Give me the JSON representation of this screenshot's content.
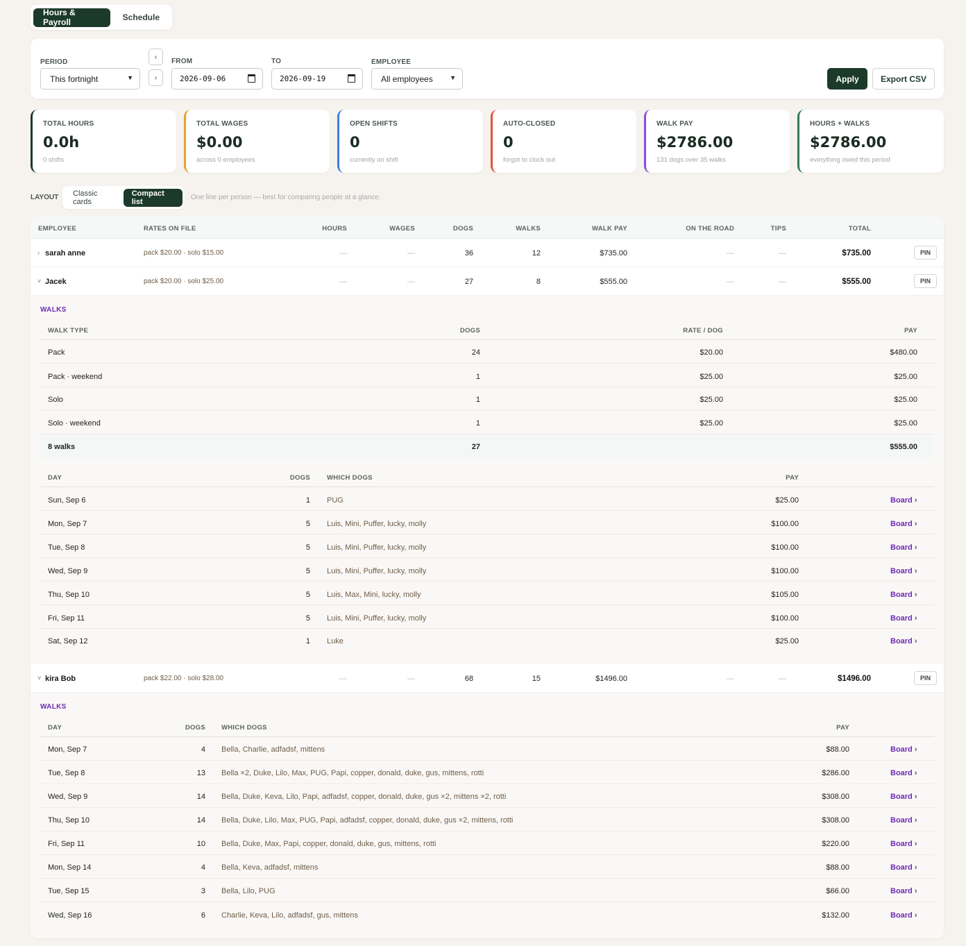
{
  "tabs": [
    {
      "label": "Hours & Payroll",
      "active": true
    },
    {
      "label": "Schedule",
      "active": false
    }
  ],
  "filters": {
    "period_label": "PERIOD",
    "period_value": "This fortnight",
    "prev_glyph": "‹",
    "next_glyph": "›",
    "from_label": "FROM",
    "from_value": "2026-09-06",
    "to_label": "TO",
    "to_value": "2026-09-19",
    "employee_label": "EMPLOYEE",
    "employee_value": "All employees",
    "apply_label": "Apply",
    "export_label": "Export CSV"
  },
  "stats": [
    {
      "label": "TOTAL HOURS",
      "value": "0.0h",
      "sub": "0 shifts",
      "color": "#1c3a2a"
    },
    {
      "label": "TOTAL WAGES",
      "value": "$0.00",
      "sub": "across 0 employees",
      "color": "#e3a52a"
    },
    {
      "label": "OPEN SHIFTS",
      "value": "0",
      "sub": "currently on shift",
      "color": "#3f7fe0"
    },
    {
      "label": "AUTO-CLOSED",
      "value": "0",
      "sub": "forgot to clock out",
      "color": "#e0533f"
    },
    {
      "label": "WALK PAY",
      "value": "$2786.00",
      "sub": "131 dogs over 35 walks",
      "color": "#8a4de0"
    },
    {
      "label": "HOURS + WALKS",
      "value": "$2786.00",
      "sub": "everything owed this period",
      "color": "#2f7a55"
    }
  ],
  "layout": {
    "label": "LAYOUT",
    "options": [
      "Classic cards",
      "Compact list"
    ],
    "active": "Compact list",
    "hint": "One line per person — best for comparing people at a glance."
  },
  "table": {
    "headers": [
      "EMPLOYEE",
      "RATES ON FILE",
      "HOURS",
      "WAGES",
      "DOGS",
      "WALKS",
      "WALK PAY",
      "ON THE ROAD",
      "TIPS",
      "TOTAL"
    ],
    "pin_label": "PIN",
    "dash": "—",
    "walks_section_label": "WALKS",
    "board_label": "Board ›",
    "employees": [
      {
        "name": "sarah anne",
        "caret": "›",
        "rates": "pack $20.00 · solo $15.00",
        "dogs": "36",
        "walks": "12",
        "walk_pay": "$735.00",
        "total": "$735.00"
      },
      {
        "name": "Jacek",
        "caret": "˅",
        "rates": "pack $20.00 · solo $25.00",
        "dogs": "27",
        "walks": "8",
        "walk_pay": "$555.00",
        "total": "$555.00"
      },
      {
        "name": "kira Bob",
        "caret": "˅",
        "rates": "pack $22.00 · solo $28.00",
        "dogs": "68",
        "walks": "15",
        "walk_pay": "$1496.00",
        "total": "$1496.00"
      }
    ],
    "jacek_types": {
      "headers": [
        "WALK TYPE",
        "DOGS",
        "RATE / DOG",
        "PAY"
      ],
      "rows": [
        {
          "type": "Pack",
          "dogs": "24",
          "rate": "$20.00",
          "pay": "$480.00"
        },
        {
          "type": "Pack · weekend",
          "dogs": "1",
          "rate": "$25.00",
          "pay": "$25.00"
        },
        {
          "type": "Solo",
          "dogs": "1",
          "rate": "$25.00",
          "pay": "$25.00"
        },
        {
          "type": "Solo · weekend",
          "dogs": "1",
          "rate": "$25.00",
          "pay": "$25.00"
        }
      ],
      "total": {
        "type": "8 walks",
        "dogs": "27",
        "pay": "$555.00"
      }
    },
    "day_headers": [
      "DAY",
      "DOGS",
      "WHICH DOGS",
      "PAY"
    ],
    "jacek_days": [
      {
        "day": "Sun, Sep 6",
        "dogs": "1",
        "which": "PUG",
        "pay": "$25.00"
      },
      {
        "day": "Mon, Sep 7",
        "dogs": "5",
        "which": "Luis, Mini, Puffer, lucky, molly",
        "pay": "$100.00"
      },
      {
        "day": "Tue, Sep 8",
        "dogs": "5",
        "which": "Luis, Mini, Puffer, lucky, molly",
        "pay": "$100.00"
      },
      {
        "day": "Wed, Sep 9",
        "dogs": "5",
        "which": "Luis, Mini, Puffer, lucky, molly",
        "pay": "$100.00"
      },
      {
        "day": "Thu, Sep 10",
        "dogs": "5",
        "which": "Luis, Max, Mini, lucky, molly",
        "pay": "$105.00"
      },
      {
        "day": "Fri, Sep 11",
        "dogs": "5",
        "which": "Luis, Mini, Puffer, lucky, molly",
        "pay": "$100.00"
      },
      {
        "day": "Sat, Sep 12",
        "dogs": "1",
        "which": "Luke",
        "pay": "$25.00"
      }
    ],
    "kira_days": [
      {
        "day": "Mon, Sep 7",
        "dogs": "4",
        "which": "Bella, Charlie, adfadsf, mittens",
        "pay": "$88.00"
      },
      {
        "day": "Tue, Sep 8",
        "dogs": "13",
        "which": "Bella ×2, Duke, Lilo, Max, PUG, Papi, copper, donald, duke, gus, mittens, rotti",
        "pay": "$286.00"
      },
      {
        "day": "Wed, Sep 9",
        "dogs": "14",
        "which": "Bella, Duke, Keva, Lilo, Papi, adfadsf, copper, donald, duke, gus ×2, mittens ×2, rotti",
        "pay": "$308.00"
      },
      {
        "day": "Thu, Sep 10",
        "dogs": "14",
        "which": "Bella, Duke, Lilo, Max, PUG, Papi, adfadsf, copper, donald, duke, gus ×2, mittens, rotti",
        "pay": "$308.00"
      },
      {
        "day": "Fri, Sep 11",
        "dogs": "10",
        "which": "Bella, Duke, Max, Papi, copper, donald, duke, gus, mittens, rotti",
        "pay": "$220.00"
      },
      {
        "day": "Mon, Sep 14",
        "dogs": "4",
        "which": "Bella, Keva, adfadsf, mittens",
        "pay": "$88.00"
      },
      {
        "day": "Tue, Sep 15",
        "dogs": "3",
        "which": "Bella, Lilo, PUG",
        "pay": "$66.00"
      },
      {
        "day": "Wed, Sep 16",
        "dogs": "6",
        "which": "Charlie, Keva, Lilo, adfadsf, gus, mittens",
        "pay": "$132.00"
      }
    ]
  }
}
